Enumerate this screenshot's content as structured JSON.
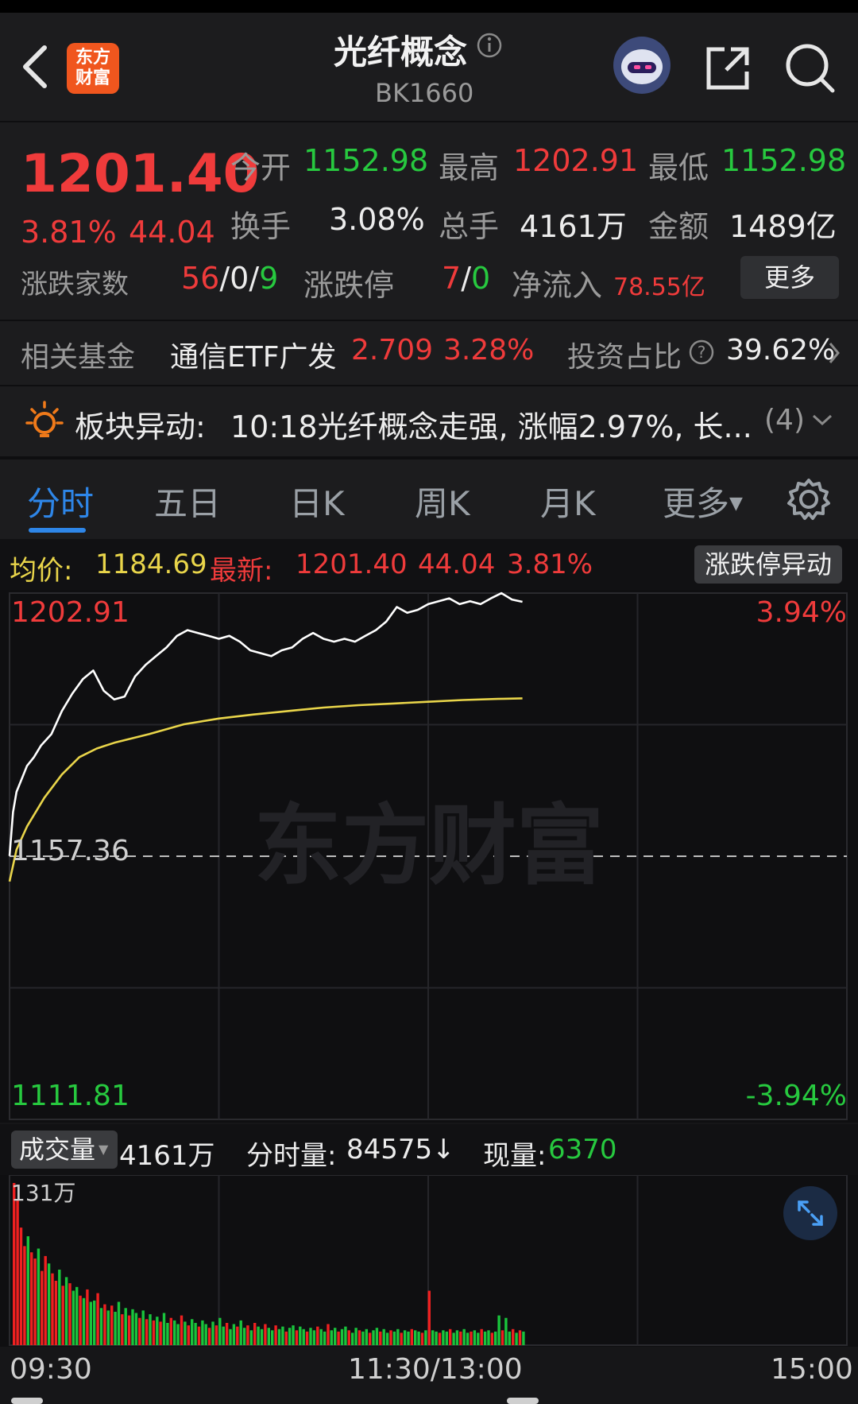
{
  "header": {
    "title": "光纤概念",
    "code": "BK1660",
    "logo_text_1": "东方",
    "logo_text_2": "财富"
  },
  "quote": {
    "price": "1201.40",
    "change_pct": "3.81%",
    "change": "44.04",
    "open_label": "今开",
    "open": "1152.98",
    "high_label": "最高",
    "high": "1202.91",
    "low_label": "最低",
    "low": "1152.98",
    "turnover_label": "换手",
    "turnover": "3.08%",
    "volume_label": "总手",
    "volume": "4161万",
    "amount_label": "金额",
    "amount": "1489亿",
    "adv_dec_label": "涨跌家数",
    "adv": "56",
    "flat_sep1": "/",
    "flat": "0",
    "flat_sep2": "/",
    "dec": "9",
    "limit_label": "涨跌停",
    "limit_up": "7",
    "limit_sep": "/",
    "limit_down": "0",
    "netflow_label": "净流入",
    "netflow": "78.55亿",
    "more_button": "更多"
  },
  "fund": {
    "label": "相关基金",
    "name": "通信ETF广发",
    "price": "2.709",
    "pct": "3.28%",
    "ratio_label": "投资占比",
    "ratio": "39.62%"
  },
  "alert": {
    "label": "板块异动:",
    "text": "10:18光纤概念走强, 涨幅2.97%, 长...",
    "count": "(4)"
  },
  "tabs": [
    "分时",
    "五日",
    "日K",
    "周K",
    "月K",
    "更多"
  ],
  "chart_header": {
    "avg_label": "均价:",
    "avg": "1184.69",
    "latest_label": "最新:",
    "latest": "1201.40",
    "change": "44.04",
    "pct": "3.81%",
    "limit_button": "涨跌停异动"
  },
  "volume_header": {
    "selector": "成交量",
    "total": "4161万",
    "minute_label": "分时量:",
    "minute_value": "84575↓",
    "current_label": "现量:",
    "current_value": "6370"
  },
  "chart_data": {
    "type": "line",
    "y_max_label": "1202.91",
    "y_mid_label": "1157.36",
    "y_min_label": "1111.81",
    "pct_max_label": "3.94%",
    "pct_min_label": "-3.94%",
    "x_labels": [
      "09:30",
      "11:30/13:00",
      "15:00"
    ],
    "volume_max_label": "131万",
    "ylim": [
      1111.81,
      1202.91
    ],
    "prev_close": 1157.36,
    "total_minutes": 240,
    "colors": {
      "price": "#ffffff",
      "avg": "#e9d54a",
      "up": "#ef2020",
      "down": "#19c43c"
    },
    "series": [
      {
        "name": "最新",
        "x": [
          0,
          1,
          2,
          3,
          5,
          7,
          9,
          12,
          15,
          18,
          21,
          24,
          27,
          30,
          33,
          36,
          39,
          42,
          45,
          48,
          51,
          54,
          57,
          60,
          63,
          66,
          69,
          72,
          75,
          78,
          81,
          84,
          87,
          90,
          93,
          96,
          99,
          102,
          105,
          108,
          111,
          114,
          117,
          120,
          123,
          126,
          129,
          132,
          135,
          138,
          141,
          144,
          147
        ],
        "values": [
          1157.4,
          1165.0,
          1168.5,
          1170.0,
          1173.0,
          1174.5,
          1176.5,
          1178.5,
          1182.5,
          1185.5,
          1188.0,
          1189.5,
          1186.0,
          1184.5,
          1185.0,
          1188.5,
          1190.5,
          1192.0,
          1193.5,
          1195.5,
          1196.5,
          1196.0,
          1195.5,
          1195.0,
          1195.5,
          1194.5,
          1193.0,
          1192.5,
          1192.0,
          1193.0,
          1193.5,
          1195.0,
          1196.0,
          1195.0,
          1194.5,
          1195.0,
          1194.5,
          1195.5,
          1196.5,
          1198.0,
          1200.5,
          1199.5,
          1200.0,
          1201.0,
          1201.5,
          1202.0,
          1201.0,
          1201.5,
          1201.0,
          1202.0,
          1202.9,
          1201.8,
          1201.4
        ]
      },
      {
        "name": "均价",
        "x": [
          0,
          2,
          5,
          10,
          15,
          20,
          25,
          30,
          40,
          50,
          60,
          70,
          80,
          90,
          100,
          110,
          120,
          130,
          140,
          147
        ],
        "values": [
          1152.98,
          1158.5,
          1162.5,
          1167.5,
          1171.5,
          1174.5,
          1176.0,
          1177.0,
          1178.5,
          1180.2,
          1181.2,
          1181.9,
          1182.5,
          1183.1,
          1183.5,
          1183.8,
          1184.1,
          1184.4,
          1184.6,
          1184.69
        ]
      }
    ],
    "volume": {
      "unit": "万",
      "ylim": [
        0,
        131
      ],
      "values": [
        131,
        118,
        95,
        80,
        88,
        75,
        70,
        78,
        60,
        72,
        66,
        58,
        52,
        61,
        48,
        55,
        50,
        44,
        47,
        40,
        38,
        45,
        35,
        36,
        42,
        30,
        33,
        28,
        32,
        27,
        35,
        25,
        30,
        24,
        29,
        26,
        22,
        28,
        21,
        25,
        20,
        23,
        19,
        26,
        18,
        22,
        20,
        17,
        24,
        19,
        16,
        21,
        18,
        15,
        20,
        17,
        14,
        19,
        16,
        22,
        15,
        18,
        13,
        17,
        15,
        20,
        14,
        16,
        12,
        18,
        15,
        13,
        17,
        14,
        12,
        16,
        13,
        15,
        11,
        14,
        16,
        12,
        15,
        13,
        11,
        14,
        12,
        15,
        13,
        11,
        17,
        12,
        14,
        11,
        13,
        15,
        12,
        10,
        14,
        12,
        11,
        13,
        10,
        12,
        14,
        11,
        13,
        10,
        12,
        11,
        13,
        10,
        12,
        11,
        13,
        12,
        11,
        10,
        12,
        44,
        12,
        11,
        10,
        12,
        11,
        13,
        10,
        12,
        11,
        13,
        10,
        11,
        12,
        10,
        13,
        11,
        12,
        10,
        11,
        24,
        12,
        22,
        11,
        13,
        10,
        12,
        11
      ],
      "colors": [
        "up",
        "up",
        "up",
        "up",
        "down",
        "up",
        "up",
        "down",
        "up",
        "up",
        "down",
        "up",
        "up",
        "down",
        "up",
        "down",
        "up",
        "down",
        "down",
        "up",
        "down",
        "up",
        "down",
        "down",
        "up",
        "down",
        "up",
        "down",
        "up",
        "down",
        "down",
        "up",
        "down",
        "up",
        "down",
        "down",
        "up",
        "down",
        "up",
        "down",
        "up",
        "down",
        "up",
        "down",
        "down",
        "up",
        "down",
        "down",
        "up",
        "down",
        "up",
        "down",
        "down",
        "up",
        "down",
        "down",
        "up",
        "down",
        "up",
        "down",
        "down",
        "up",
        "down",
        "down",
        "up",
        "down",
        "down",
        "up",
        "down",
        "up",
        "down",
        "down",
        "up",
        "down",
        "down",
        "up",
        "down",
        "down",
        "up",
        "down",
        "down",
        "up",
        "down",
        "down",
        "up",
        "down",
        "down",
        "up",
        "down",
        "down",
        "up",
        "down",
        "down",
        "up",
        "down",
        "down",
        "up",
        "down",
        "down",
        "up",
        "down",
        "down",
        "up",
        "down",
        "down",
        "up",
        "down",
        "down",
        "up",
        "down",
        "down",
        "up",
        "down",
        "down",
        "up",
        "down",
        "down",
        "up",
        "down",
        "up",
        "down",
        "down",
        "up",
        "down",
        "down",
        "up",
        "down",
        "down",
        "up",
        "down",
        "down",
        "up",
        "down",
        "down",
        "up",
        "down",
        "down",
        "up",
        "down",
        "down",
        "up",
        "down",
        "down",
        "up",
        "down",
        "up",
        "down"
      ]
    }
  }
}
